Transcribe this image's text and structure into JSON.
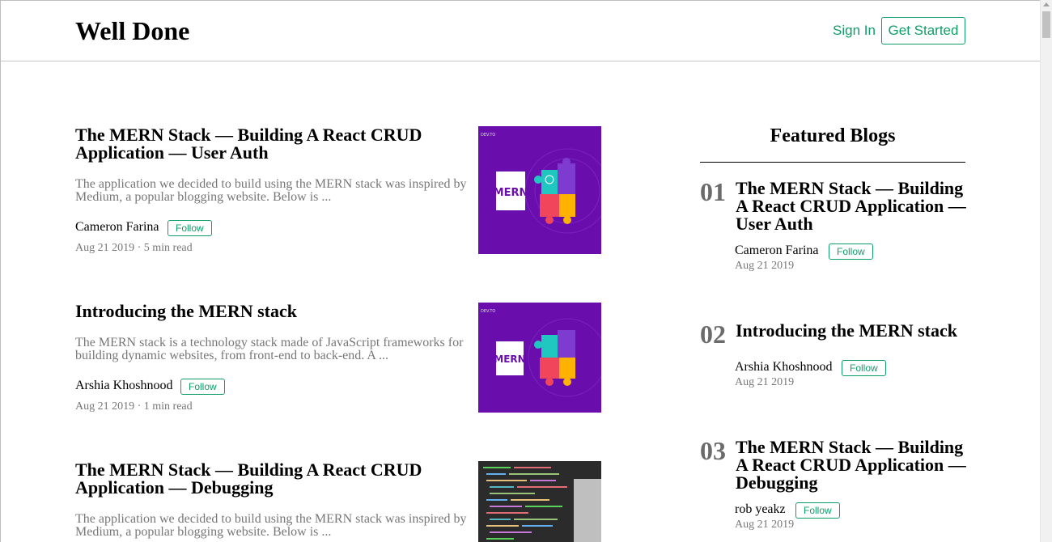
{
  "site": {
    "logo": "Well Done",
    "sign_in": "Sign In",
    "get_started": "Get Started"
  },
  "articles": [
    {
      "title": "The MERN Stack — Building A React CRUD Application — User Auth",
      "excerpt": "The application we decided to build using the MERN stack was inspired by Medium, a popular blogging website. Below is ...",
      "author": "Cameron Farina",
      "follow": "Follow",
      "meta": "Aug 21 2019 · 5 min read",
      "image": "mern-puzzle",
      "image_caption": "mern",
      "image_badge": "DEV.TO"
    },
    {
      "title": "Introducing the MERN stack",
      "excerpt": "The MERN stack is a technology stack made of JavaScript frameworks for building dynamic websites, from front-end to back-end. A ...",
      "author": "Arshia Khoshnood",
      "follow": "Follow",
      "meta": "Aug 21 2019 · 1 min read",
      "image": "mern-puzzle",
      "image_caption": "mern",
      "image_badge": "DEV.TO"
    },
    {
      "title": "The MERN Stack — Building A React CRUD Application — Debugging",
      "excerpt": "The application we decided to build using the MERN stack was inspired by Medium, a popular blogging website. Below is ...",
      "author": "",
      "follow": "",
      "meta": "",
      "image": "code-screen"
    }
  ],
  "featured": {
    "heading": "Featured Blogs",
    "items": [
      {
        "num": "01",
        "title": "The MERN Stack — Building A React CRUD Application — User Auth",
        "author": "Cameron Farina",
        "follow": "Follow",
        "date": "Aug 21 2019"
      },
      {
        "num": "02",
        "title": "Introducing the MERN stack",
        "author": "Arshia Khoshnood",
        "follow": "Follow",
        "date": "Aug 21 2019"
      },
      {
        "num": "03",
        "title": "The MERN Stack — Building A React CRUD Application — Debugging",
        "author": "rob yeakz",
        "follow": "Follow",
        "date": "Aug 21 2019"
      }
    ]
  },
  "colors": {
    "accent": "#0f9d68",
    "muted": "#777777",
    "thumb_bg": "#6a0dad"
  }
}
